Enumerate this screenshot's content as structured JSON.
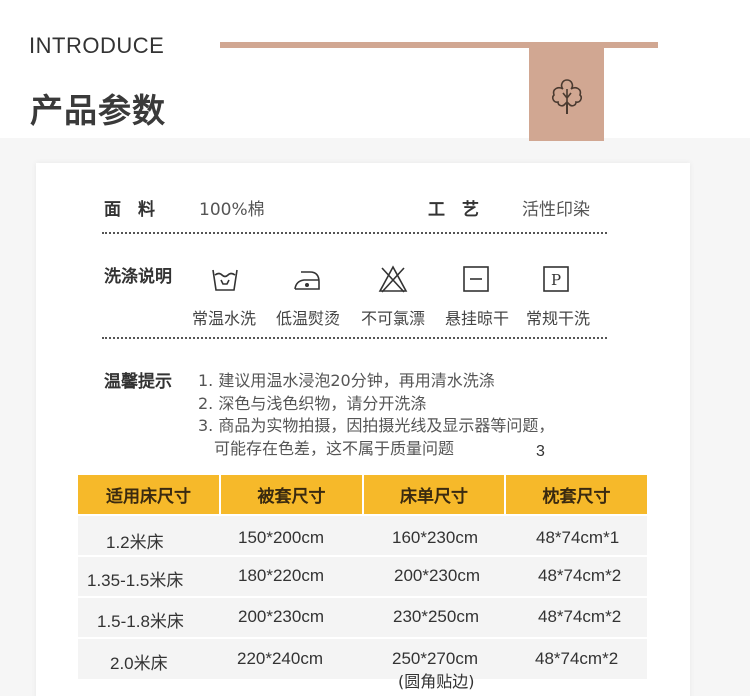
{
  "header": {
    "introduce": "INTRODUCE",
    "title": "产品参数"
  },
  "params": {
    "material_label": "面　料",
    "material_value": "100%棉",
    "craft_label": "工　艺",
    "craft_value": "活性印染"
  },
  "washing": {
    "label": "洗涤说明",
    "items": [
      {
        "icon": "wash-tub-icon",
        "label": "常温水洗"
      },
      {
        "icon": "iron-icon",
        "label": "低温熨烫"
      },
      {
        "icon": "no-bleach-icon",
        "label": "不可氯漂"
      },
      {
        "icon": "hang-dry-icon",
        "label": "悬挂晾干"
      },
      {
        "icon": "dry-clean-icon",
        "label": "常规干洗"
      }
    ]
  },
  "tips": {
    "label": "温馨提示",
    "lines": [
      "1. 建议用温水浸泡20分钟，再用清水洗涤",
      "2. 深色与浅色织物，请分开洗涤",
      "3. 商品为实物拍摄，因拍摄光线及显示器等问题，",
      "可能存在色差，这不属于质量问题"
    ],
    "note": "3"
  },
  "size_table": {
    "headers": [
      "适用床尺寸",
      "被套尺寸",
      "床单尺寸",
      "枕套尺寸"
    ],
    "rows": [
      [
        "1.2米床",
        "150*200cm",
        "160*230cm",
        "48*74cm*1"
      ],
      [
        "1.35-1.5米床",
        "180*220cm",
        "200*230cm",
        "48*74cm*2"
      ],
      [
        "1.5-1.8米床",
        "200*230cm",
        "230*250cm",
        "48*74cm*2"
      ],
      [
        "2.0米床",
        "220*240cm",
        "250*270cm",
        "48*74cm*2"
      ]
    ],
    "footnote": "(圆角贴边)"
  },
  "colors": {
    "accent": "#d1a792",
    "table_header": "#f6b92a"
  }
}
